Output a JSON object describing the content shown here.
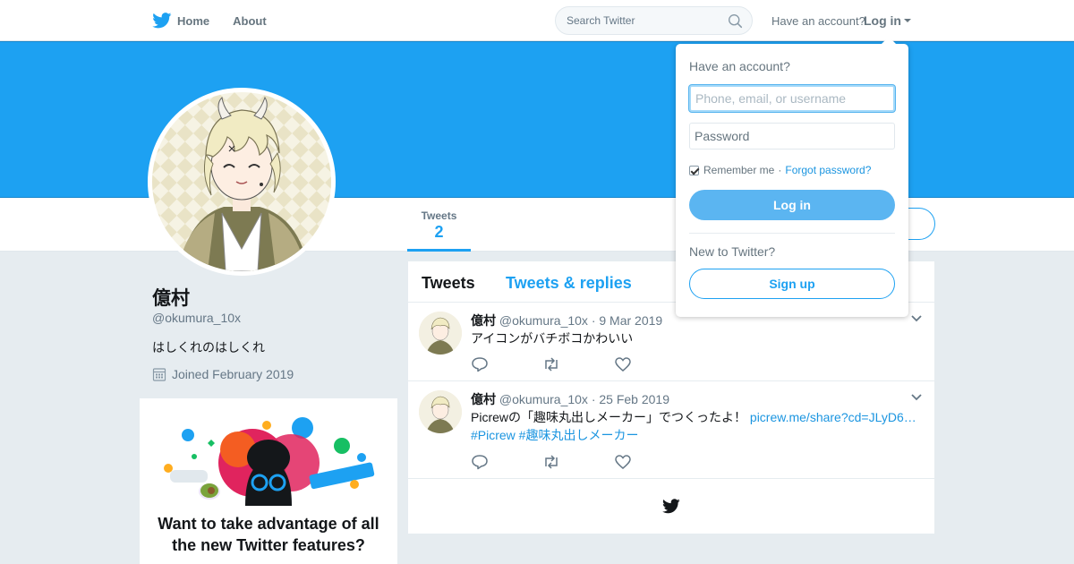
{
  "nav": {
    "home_label": "Home",
    "about_label": "About",
    "search_placeholder": "Search Twitter",
    "have_account": "Have an account?",
    "login_label": "Log in"
  },
  "colors": {
    "brand": "#1da1f2",
    "link": "#1b95e0",
    "background": "#e6ecf0"
  },
  "profile": {
    "name": "億村",
    "handle": "@okumura_10x",
    "bio": "はしくれのはしくれ",
    "joined": "Joined February 2019",
    "stats": [
      {
        "label": "Tweets",
        "value": "2"
      }
    ]
  },
  "promo": {
    "title": "Want to take advantage of all the new Twitter features?"
  },
  "timeline": {
    "tabs": [
      "Tweets",
      "Tweets & replies"
    ],
    "tweets": [
      {
        "name": "億村",
        "handle": "@okumura_10x",
        "date": "· 9 Mar 2019",
        "text": "アイコンがバチボコかわいい",
        "link": "",
        "hashtags": ""
      },
      {
        "name": "億村",
        "handle": "@okumura_10x",
        "date": "· 25 Feb 2019",
        "text": "Picrewの「趣味丸出しメーカー」でつくったよ！ ",
        "link": "picrew.me/share?cd=JLyD6…",
        "hashtags": "#Picrew #趣味丸出しメーカー"
      }
    ],
    "actions": [
      "reply-icon",
      "retweet-icon",
      "like-icon"
    ]
  },
  "login_dropdown": {
    "heading": "Have an account?",
    "username_placeholder": "Phone, email, or username",
    "password_placeholder": "Password",
    "remember_label": "Remember me",
    "remember_checked": true,
    "separator": "·",
    "forgot_label": "Forgot password?",
    "login_button": "Log in",
    "new_prompt": "New to Twitter?",
    "signup_button": "Sign up"
  }
}
